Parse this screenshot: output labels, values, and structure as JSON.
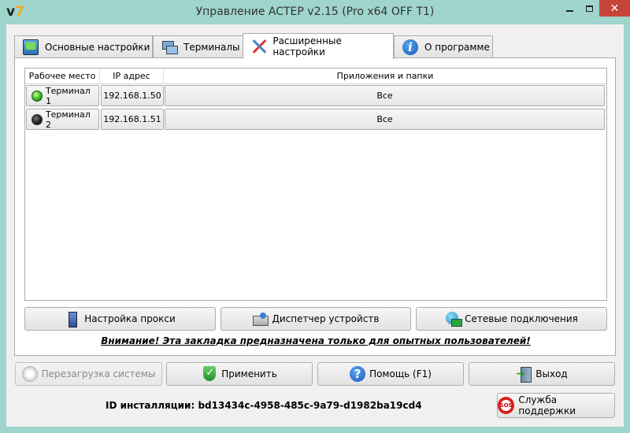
{
  "window": {
    "title": "Управление ACTEP v2.15 (Pro x64 OFF T1)",
    "app_icon_text_v": "v",
    "app_icon_text_7": "7",
    "controls": {
      "minimize": "",
      "maximize": "",
      "close": "✕"
    }
  },
  "tabs": [
    {
      "label": "Основные настройки",
      "icon": "monitor-settings-icon",
      "active": false
    },
    {
      "label": "Терминалы",
      "icon": "terminals-icon",
      "active": false
    },
    {
      "label": "Расширенные настройки",
      "icon": "tools-icon",
      "active": true
    },
    {
      "label": "О программе",
      "icon": "info-icon",
      "active": false
    }
  ],
  "table": {
    "columns": [
      "Рабочее место",
      "IP адрес",
      "Приложения и папки"
    ],
    "rows": [
      {
        "workstation": "Терминал 1",
        "ip": "192.168.1.50",
        "apps": "Все",
        "status": "online",
        "status_color": "#39b41b"
      },
      {
        "workstation": "Терминал 2",
        "ip": "192.168.1.51",
        "apps": "Все",
        "status": "offline",
        "status_color": "#222222"
      }
    ]
  },
  "panel_buttons": {
    "proxy": "Настройка прокси",
    "devices": "Диспетчер устройств",
    "network": "Сетевые подключения"
  },
  "warning_text": "Внимание! Эта закладка предназначена только для опытных пользователей!",
  "footer": {
    "reboot": "Перезагрузка системы",
    "apply": "Применить",
    "help": "Помощь (F1)",
    "exit": "Выход",
    "support": "Служба поддержки",
    "install_id": "ID инсталляции: bd13434c-4958-485c-9a79-d1982ba19cd4",
    "help_icon_glyph": "?",
    "info_icon_glyph": "i",
    "sos_icon_text": "SOS"
  },
  "colors": {
    "window_frame": "#9fd5cd",
    "close_button": "#c7443a",
    "client_bg": "#f0f0f0"
  }
}
